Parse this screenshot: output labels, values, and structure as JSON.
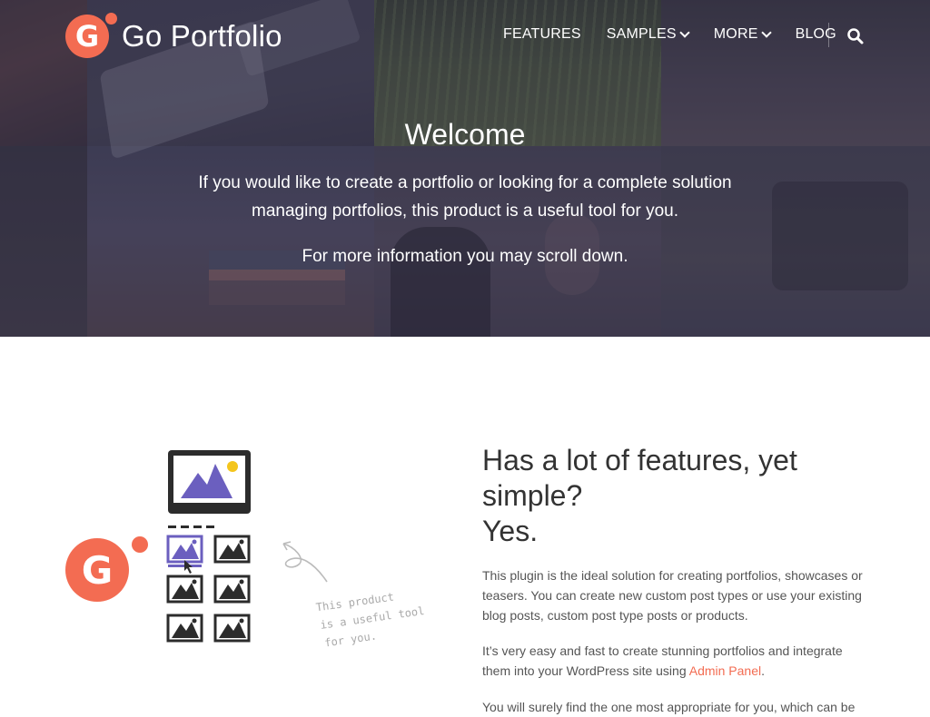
{
  "brand": {
    "name": "Go Portfolio",
    "letter": "G"
  },
  "nav": {
    "items": [
      {
        "label": "FEATURES",
        "dropdown": false
      },
      {
        "label": "SAMPLES",
        "dropdown": true
      },
      {
        "label": "MORE",
        "dropdown": true
      },
      {
        "label": "BLOG",
        "dropdown": false
      }
    ],
    "search_icon": "search-icon"
  },
  "hero": {
    "title": "Welcome",
    "line1": "If you would like to create a portfolio or looking for a complete solution",
    "line2": "managing portfolios, this product is a useful tool for you.",
    "line3": "For more information you may scroll down."
  },
  "features": {
    "title_line1": "Has a lot of features, yet",
    "title_line2": "simple?",
    "title_line3": "Yes.",
    "p1": "This plugin is the ideal solution for creating portfolios, showcases or teasers. You can create new custom post types or use your existing blog posts, custom post type posts or products.",
    "p2_before": "It’s very easy and fast to create stunning portfolios and integrate them into your WordPress site using ",
    "p2_link": "Admin Panel",
    "p2_after": ".",
    "p3": "You will surely find the one most appropriate for you, which can be"
  },
  "illustration": {
    "note_line1": "This product",
    "note_line2": "is a useful tool",
    "note_line3": "for you."
  },
  "colors": {
    "accent": "#f36c52",
    "purple": "#6b5fbf",
    "yellow": "#f4c51c",
    "dark": "#2c2c2c"
  }
}
